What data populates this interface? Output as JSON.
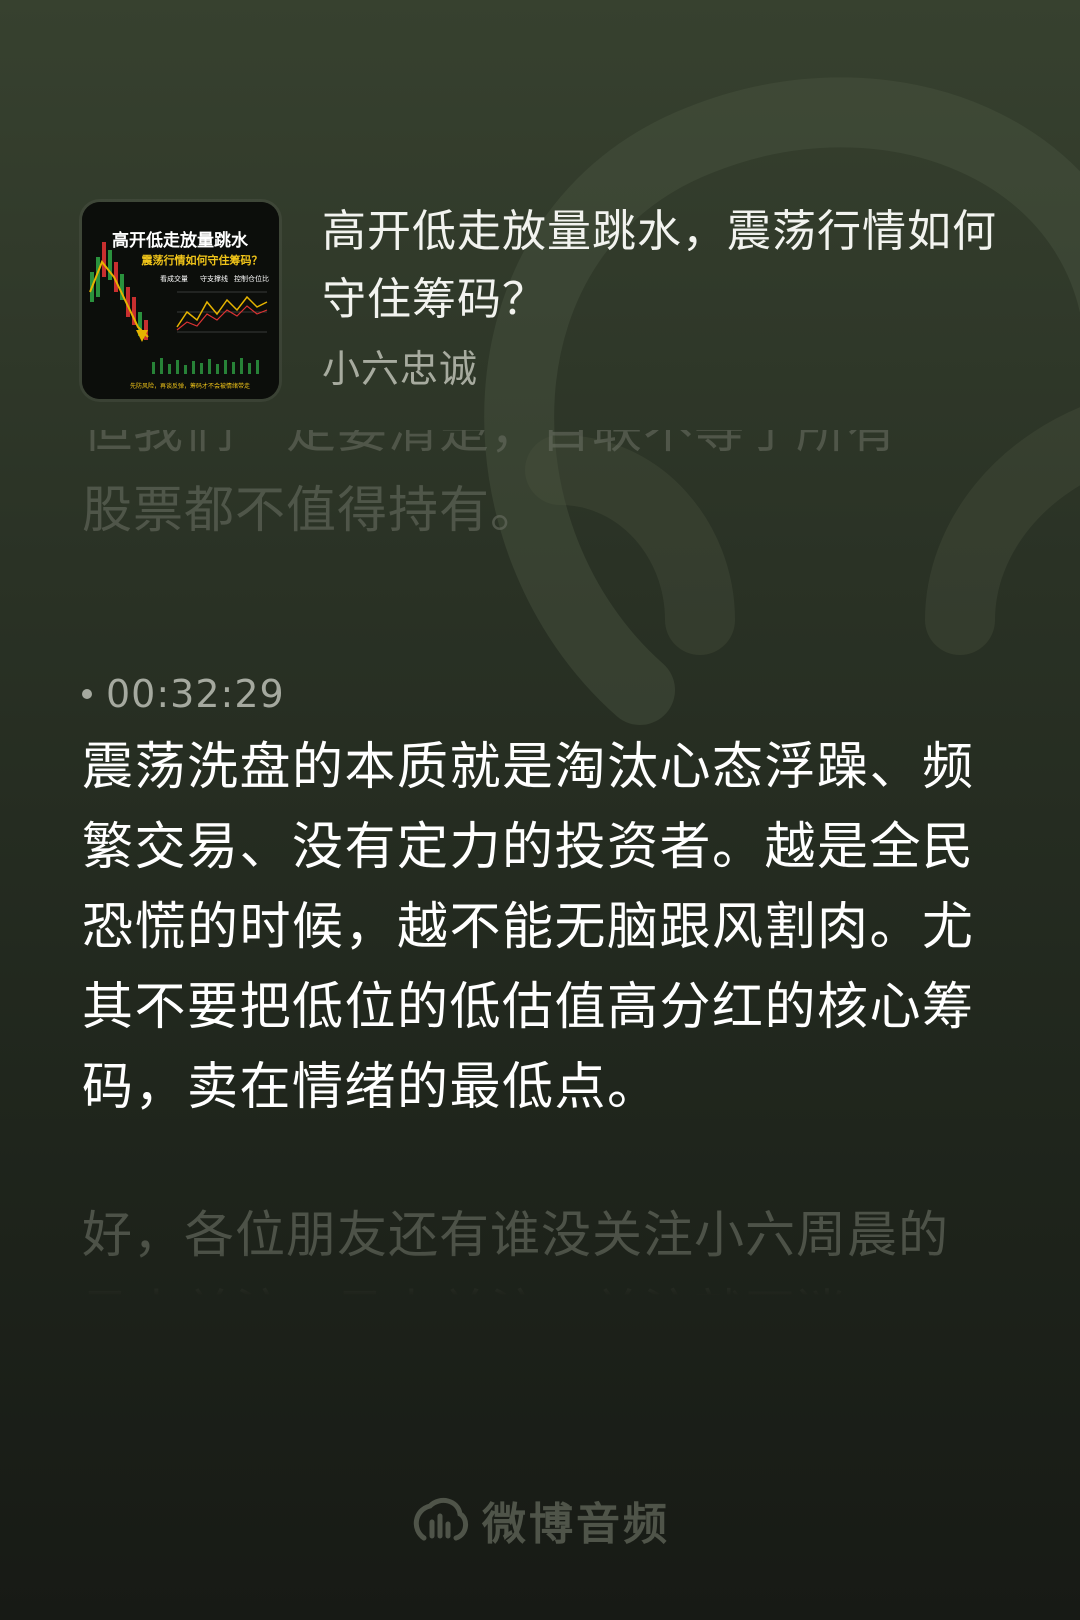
{
  "episode": {
    "title": "高开低走放量跳水，震荡行情如何守住筹码？",
    "author": "小六忠诚",
    "cover": {
      "headline": "高开低走放量跳水",
      "subheadline": "震荡行情如何守住筹码？",
      "tags": [
        "看成交量",
        "守支撑线",
        "控制仓位比"
      ],
      "footer": "先防风险，再谈反弹，筹码才不会被情绪带走"
    }
  },
  "transcript": {
    "previous_text": "股票都不值得持有。",
    "previous_cut_text": "但我们一定要清楚，目联不等于所有",
    "current_timestamp": "00:32:29",
    "current_text": "震荡洗盘的本质就是淘汰心态浮躁、频繁交易、没有定力的投资者。越是全民恐慌的时候，越不能无脑跟风割肉。尤其不要把低位的低估值高分红的核心筹码，卖在情绪的最低点。",
    "next_text": "好，各位朋友还有谁没关注小六周晨的马上关注，马上关注，关注就不迷"
  },
  "brand": {
    "name": "微博音频",
    "icon": "weibo-audio-logo-icon"
  }
}
